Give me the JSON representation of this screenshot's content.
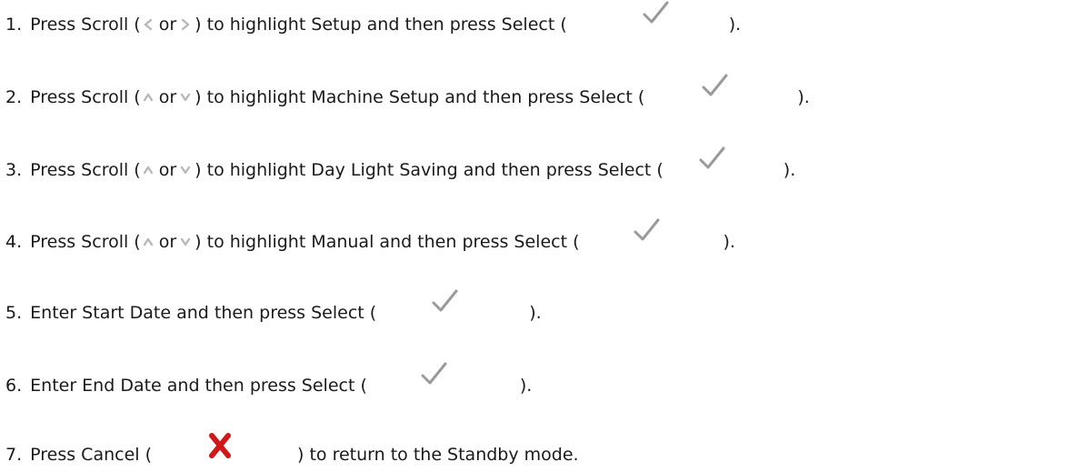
{
  "steps": [
    {
      "number": "1.",
      "p1": "Press Scroll (",
      "arrow_a": "left-arrow-icon",
      "or": "or",
      "arrow_b": "right-arrow-icon",
      "p2": ") to highlight Setup and then press Select (",
      "icon": "check-icon",
      "end": ")."
    },
    {
      "number": "2.",
      "p1": "Press Scroll (",
      "arrow_a": "up-arrow-icon",
      "or": "or",
      "arrow_b": "down-arrow-icon",
      "p2": ") to highlight Machine Setup and then press Select (",
      "icon": "check-icon",
      "end": ")."
    },
    {
      "number": "3.",
      "p1": "Press Scroll (",
      "arrow_a": "up-arrow-icon",
      "or": "or",
      "arrow_b": "down-arrow-icon",
      "p2": ") to highlight Day Light Saving and then press Select (",
      "icon": "check-icon",
      "end": ")."
    },
    {
      "number": "4.",
      "p1": "Press Scroll (",
      "arrow_a": "up-arrow-icon",
      "or": "or",
      "arrow_b": "down-arrow-icon",
      "p2": ") to highlight Manual and then press Select (",
      "icon": "check-icon",
      "end": ")."
    },
    {
      "number": "5.",
      "p1": "Enter Start Date and then press Select (",
      "icon": "check-icon",
      "end": ")."
    },
    {
      "number": "6.",
      "p1": "Enter End Date and then press Select (",
      "icon": "check-icon",
      "end": ")."
    },
    {
      "number": "7.",
      "p1": "Press Cancel (",
      "icon": "cancel-x-icon",
      "end": ") to return to the Standby mode."
    }
  ],
  "colors": {
    "text": "#1a1a1a",
    "arrow": "#b8b8b8",
    "check": "#9a9a9a",
    "cancel": "#d01818"
  }
}
